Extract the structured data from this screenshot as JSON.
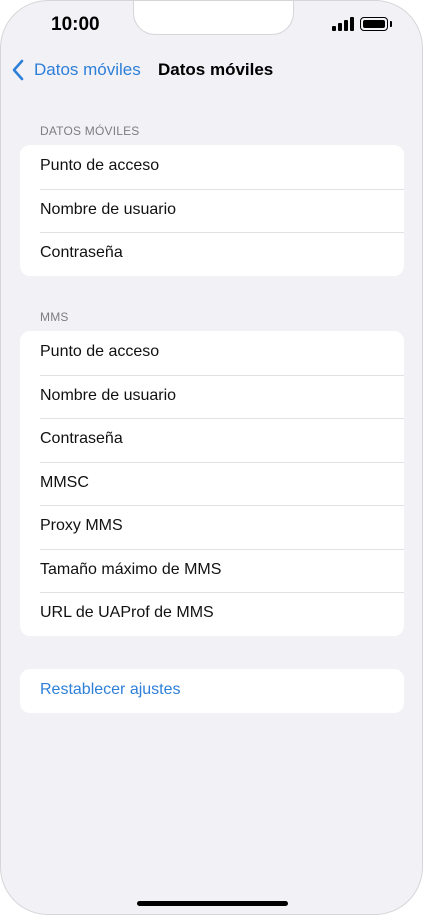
{
  "status_bar": {
    "time": "10:00",
    "icons": [
      "signal-icon",
      "battery-icon"
    ]
  },
  "nav": {
    "back_label": "Datos móviles",
    "title": "Datos móviles",
    "back_icon": "chevron-left-icon"
  },
  "sections": {
    "mobile_data": {
      "header": "DATOS MÓVILES",
      "items": [
        {
          "label": "Punto de acceso"
        },
        {
          "label": "Nombre de usuario"
        },
        {
          "label": "Contraseña"
        }
      ]
    },
    "mms": {
      "header": "MMS",
      "items": [
        {
          "label": "Punto de acceso"
        },
        {
          "label": "Nombre de usuario"
        },
        {
          "label": "Contraseña"
        },
        {
          "label": "MMSC"
        },
        {
          "label": "Proxy MMS"
        },
        {
          "label": "Tamaño máximo de MMS"
        },
        {
          "label": "URL de UAProf de MMS"
        }
      ]
    },
    "reset": {
      "label": "Restablecer ajustes"
    }
  },
  "colors": {
    "accent": "#2e7fd8",
    "background": "#f1f1f6",
    "card": "#ffffff",
    "section_header": "#7d7d82"
  }
}
